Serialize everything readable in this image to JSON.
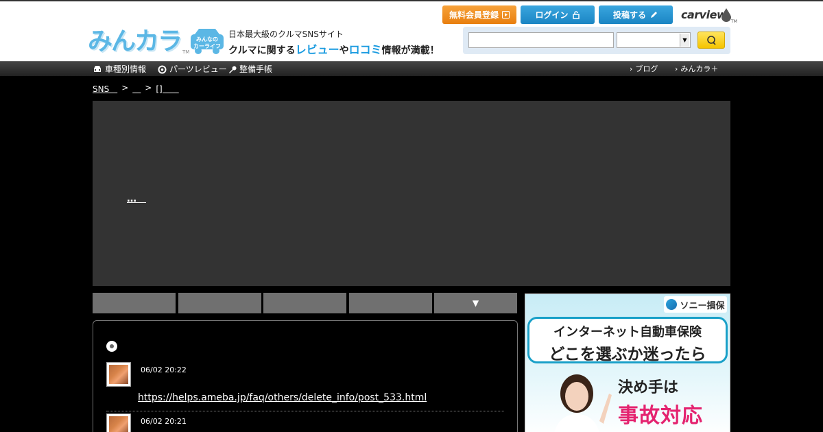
{
  "header": {
    "logo_text": "みんカラ",
    "logo_tm": "TM",
    "badge_text": "みんなの カーライフ",
    "tagline1": "日本最大級のクルマSNSサイト",
    "tagline2_a": "クルマに関する",
    "tagline2_b": "レビュー",
    "tagline2_c": "や",
    "tagline2_d": "ロコミ",
    "tagline2_e": "情報が満載！",
    "register_label": "無料会員登録",
    "login_label": "ログイン",
    "post_label": "投稿する",
    "carview_label": "carview",
    "carview_tm": "TM",
    "search_value": "",
    "select_value": ""
  },
  "nav": {
    "items": [
      {
        "label": "車種別情報",
        "icon": "car-icon"
      },
      {
        "label": "パーツレビュー",
        "icon": "gear-icon"
      },
      {
        "label": "整備手帳",
        "icon": "wrench-icon"
      }
    ],
    "right_items": [
      {
        "label": "ブログ"
      },
      {
        "label": "みんカラ＋"
      }
    ]
  },
  "breadcrumb": {
    "item1": "SNS　",
    "sep": ">",
    "item2": "＿",
    "item3": "[]　　"
  },
  "hero": {
    "link_text": "…　"
  },
  "tabs": {
    "labels": [
      "",
      "",
      "",
      "",
      "▼"
    ]
  },
  "entries": [
    {
      "date": "06/02 20:22",
      "link": "https://helps.ameba.jp/faq/others/delete_info/post_533.html"
    },
    {
      "date": "06/02 20:21"
    }
  ],
  "ad": {
    "brand": "ソニー損保",
    "line1": "インターネット自動車保険",
    "line2": "どこを選ぶか迷ったら",
    "line3": "決め手は",
    "line4": "事故対応"
  },
  "colors": {
    "accent_blue": "#1a9be0",
    "register_orange": "#f39019",
    "ad_pink": "#e4236f"
  }
}
